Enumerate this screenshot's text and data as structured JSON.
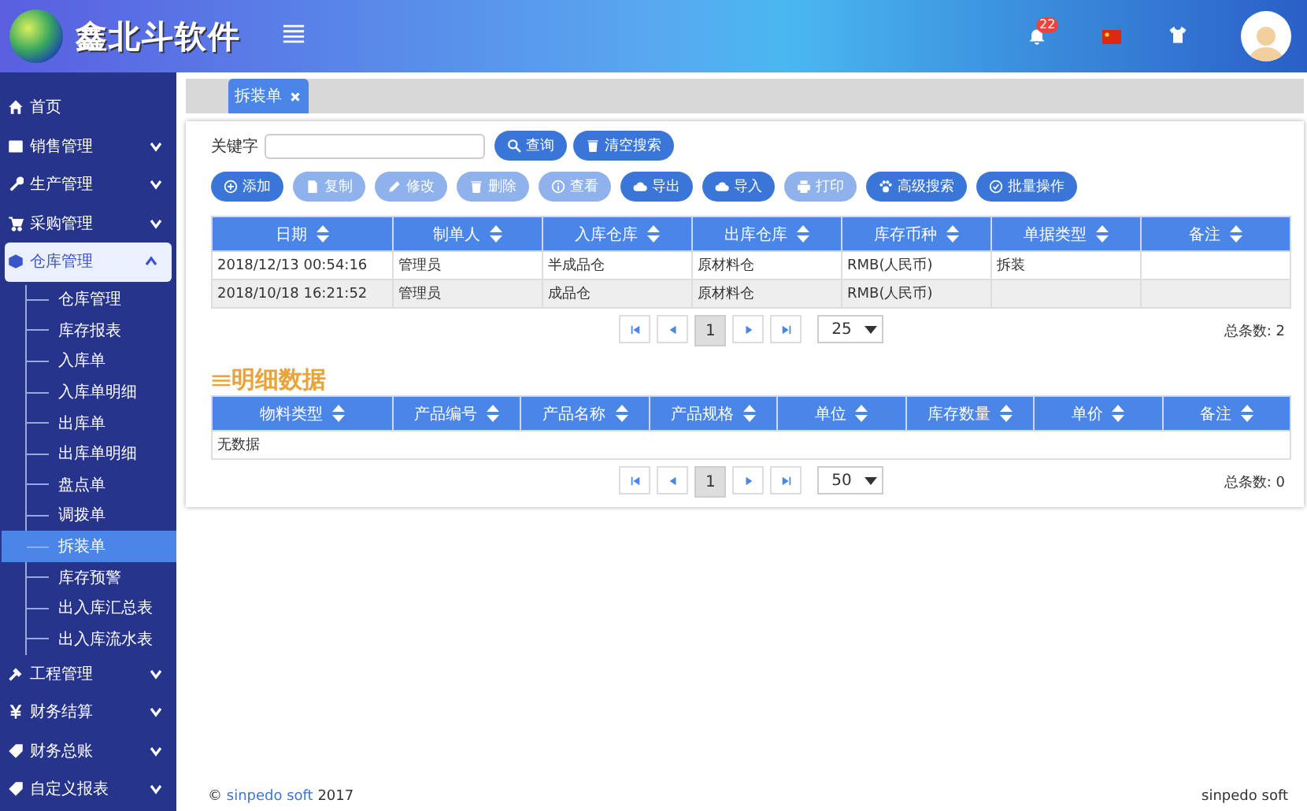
{
  "header": {
    "title": "鑫北斗软件",
    "notification_count": "22"
  },
  "sidebar": {
    "items": [
      {
        "label": "首页",
        "kind": "link"
      },
      {
        "label": "销售管理",
        "kind": "group",
        "expanded": false
      },
      {
        "label": "生产管理",
        "kind": "group",
        "expanded": false
      },
      {
        "label": "采购管理",
        "kind": "group",
        "expanded": false
      },
      {
        "label": "仓库管理",
        "kind": "group",
        "expanded": true,
        "children": [
          {
            "label": "仓库管理",
            "selected": false
          },
          {
            "label": "库存报表",
            "selected": false
          },
          {
            "label": "入库单",
            "selected": false
          },
          {
            "label": "入库单明细",
            "selected": false
          },
          {
            "label": "出库单",
            "selected": false
          },
          {
            "label": "出库单明细",
            "selected": false
          },
          {
            "label": "盘点单",
            "selected": false
          },
          {
            "label": "调拨单",
            "selected": false
          },
          {
            "label": "拆装单",
            "selected": true
          },
          {
            "label": "库存预警",
            "selected": false
          },
          {
            "label": "出入库汇总表",
            "selected": false
          },
          {
            "label": "出入库流水表",
            "selected": false
          }
        ]
      },
      {
        "label": "工程管理",
        "kind": "group",
        "expanded": false
      },
      {
        "label": "财务结算",
        "kind": "group",
        "expanded": false
      },
      {
        "label": "财务总账",
        "kind": "group",
        "expanded": false
      },
      {
        "label": "自定义报表",
        "kind": "group",
        "expanded": false
      }
    ]
  },
  "tabs": [
    {
      "label": "拆装单",
      "selected": true
    }
  ],
  "search": {
    "label": "关键字",
    "buttons": [
      "查询",
      "清空搜索"
    ]
  },
  "toolbar": [
    {
      "label": "添加",
      "disabled": false
    },
    {
      "label": "复制",
      "disabled": true
    },
    {
      "label": "修改",
      "disabled": true
    },
    {
      "label": "删除",
      "disabled": true
    },
    {
      "label": "查看",
      "disabled": true
    },
    {
      "label": "导出",
      "disabled": false
    },
    {
      "label": "导入",
      "disabled": false
    },
    {
      "label": "打印",
      "disabled": true
    },
    {
      "label": "高级搜索",
      "disabled": false
    },
    {
      "label": "批量操作",
      "disabled": false
    }
  ],
  "main_table": {
    "columns": [
      "日期",
      "制单人",
      "入库仓库",
      "出库仓库",
      "库存币种",
      "单据类型",
      "备注"
    ],
    "rows": [
      [
        "2018/12/13 00:54:16",
        "管理员",
        "半成品仓",
        "原材料仓",
        "RMB(人民币)",
        "拆装",
        ""
      ],
      [
        "2018/10/18 16:21:52",
        "管理员",
        "成品仓",
        "原材料仓",
        "RMB(人民币)",
        "",
        ""
      ]
    ],
    "page": "1",
    "page_size": "25",
    "total": "总条数: 2"
  },
  "detail": {
    "title": "明细数据",
    "columns": [
      "物料类型",
      "产品编号",
      "产品名称",
      "产品规格",
      "单位",
      "库存数量",
      "单价",
      "备注"
    ],
    "empty_text": "无数据",
    "page": "1",
    "page_size": "50",
    "total": "总条数: 0"
  },
  "footer": {
    "copyright": "© ",
    "link": "sinpedo soft",
    "year": " 2017",
    "brand": "sinpedo soft"
  }
}
